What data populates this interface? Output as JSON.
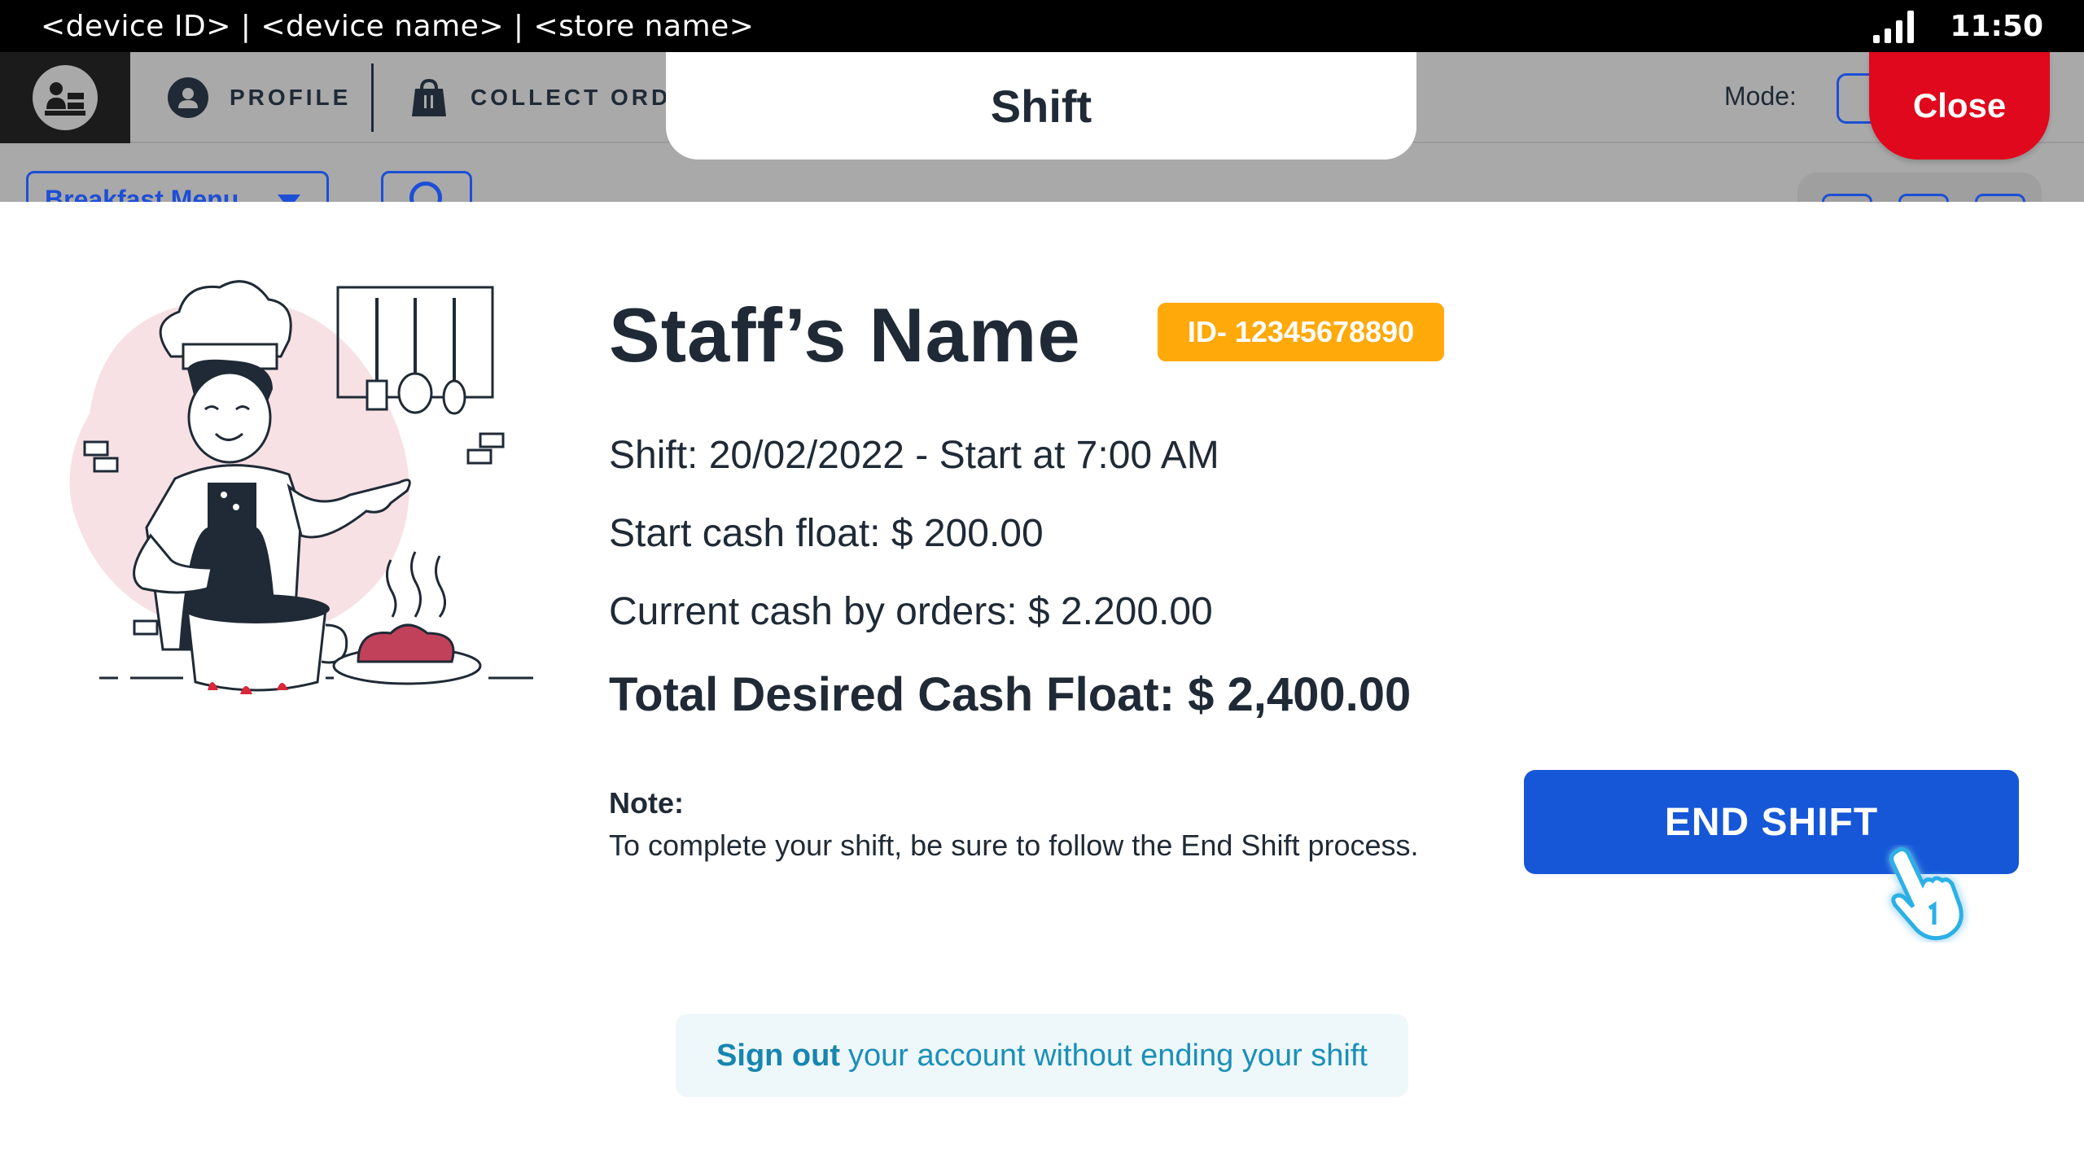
{
  "status_bar": {
    "device_info": "<device ID> | <device name> | <store name>",
    "time": "11:50",
    "signal_icon": "signal-bars-icon"
  },
  "app_header": {
    "profile_label": "PROFILE",
    "collect_orders_label": "COLLECT ORDE",
    "mode_label": "Mode:"
  },
  "toolbar": {
    "menu_select_value": "Breakfast Menu"
  },
  "modal": {
    "title": "Shift",
    "close_label": "Close",
    "staff_name": "Staff’s Name",
    "staff_id": "ID- 12345678890",
    "shift_line": "Shift: 20/02/2022 - Start at 7:00 AM",
    "start_cash_float": "Start cash float: $ 200.00",
    "current_cash": "Current cash by orders: $ 2.200.00",
    "total_desired": "Total Desired Cash Float: $ 2,400.00",
    "note_label": "Note:",
    "note_text": "To complete your shift, be sure to follow the End Shift process.",
    "end_shift_label": "END SHIFT",
    "sign_out_strong": "Sign out",
    "sign_out_rest": "your account without ending your shift"
  },
  "colors": {
    "primary_blue": "#1657d8",
    "close_red": "#e0081c",
    "badge_orange": "#ffa90a",
    "text_dark": "#1f2a36",
    "signout_bg": "#eef7fa",
    "signout_text": "#1a8fb8"
  }
}
